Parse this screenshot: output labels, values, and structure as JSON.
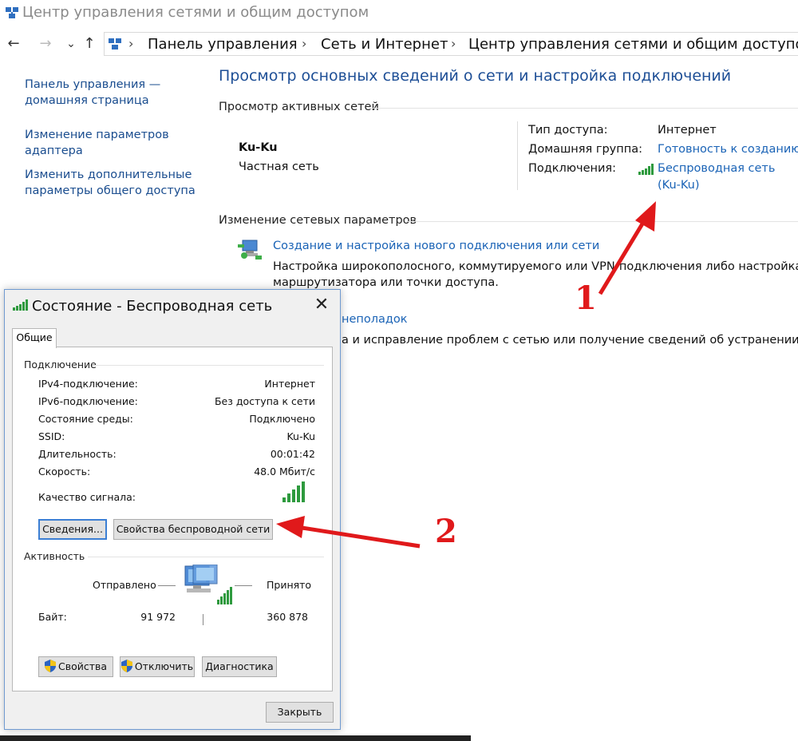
{
  "window": {
    "title": "Центр управления сетями и общим доступом"
  },
  "address_bar": {
    "crumbs": [
      "Панель управления",
      "Сеть и Интернет",
      "Центр управления сетями и общим доступом"
    ],
    "separator": "›"
  },
  "nav_icons": {
    "back": "←",
    "forward": "→",
    "recent": "⌄",
    "up": "↑",
    "crumb_expand": "›"
  },
  "sidebar": {
    "items": [
      {
        "label": "Панель управления —\nдомашняя страница"
      },
      {
        "label": "Изменение параметров\nадаптера"
      },
      {
        "label": "Изменить дополнительные\nпараметры общего доступа"
      }
    ]
  },
  "main": {
    "heading": "Просмотр основных сведений о сети и настройка подключений",
    "active_networks_title": "Просмотр активных сетей",
    "network_name": "Ku-Ku",
    "network_type": "Частная сеть",
    "access_type_label": "Тип доступа:",
    "access_type_value": "Интернет",
    "homegroup_label": "Домашняя группа:",
    "homegroup_value": "Готовность к созданию",
    "connections_label": "Подключения:",
    "connections_value_line1": "Беспроводная сеть",
    "connections_value_line2": "(Ku-Ku)",
    "change_settings_title": "Изменение сетевых параметров",
    "new_connection_link": "Создание и настройка нового подключения или сети",
    "new_connection_desc_line1": "Настройка широкополосного, коммутируемого или VPN-подключения либо настройка",
    "new_connection_desc_line2": "маршрутизатора или точки доступа.",
    "troubleshoot_link_partial": "неполадок",
    "troubleshoot_desc_partial": "а и исправление проблем с сетью или получение сведений об устранении"
  },
  "dialog": {
    "title": "Состояние - Беспроводная сеть",
    "close": "✕",
    "tab_general": "Общие",
    "connection_group": "Подключение",
    "rows": [
      {
        "label": "IPv4-подключение:",
        "value": "Интернет"
      },
      {
        "label": "IPv6-подключение:",
        "value": "Без доступа к сети"
      },
      {
        "label": "Состояние среды:",
        "value": "Подключено"
      },
      {
        "label": "SSID:",
        "value": "Ku-Ku"
      },
      {
        "label": "Длительность:",
        "value": "00:01:42"
      },
      {
        "label": "Скорость:",
        "value": "48.0 Мбит/с"
      }
    ],
    "signal_label": "Качество сигнала:",
    "signal_bars": 5,
    "details_button": "Сведения...",
    "wireless_props_button": "Свойства беспроводной сети",
    "activity_group": "Активность",
    "sent_label": "Отправлено",
    "received_label": "Принято",
    "bytes_label": "Байт:",
    "bytes_sent": "91 972",
    "bytes_received": "360 878",
    "properties_button": "Свойства",
    "disable_button": "Отключить",
    "diagnose_button": "Диагностика",
    "close_button": "Закрыть"
  },
  "annotations": {
    "arrow1_label": "1",
    "arrow2_label": "2",
    "color": "#e0191b"
  },
  "colors": {
    "link": "#1a63b6",
    "heading": "#1e4f96",
    "signal": "#2e9a3e",
    "dialog_border": "#6f9ad1"
  }
}
